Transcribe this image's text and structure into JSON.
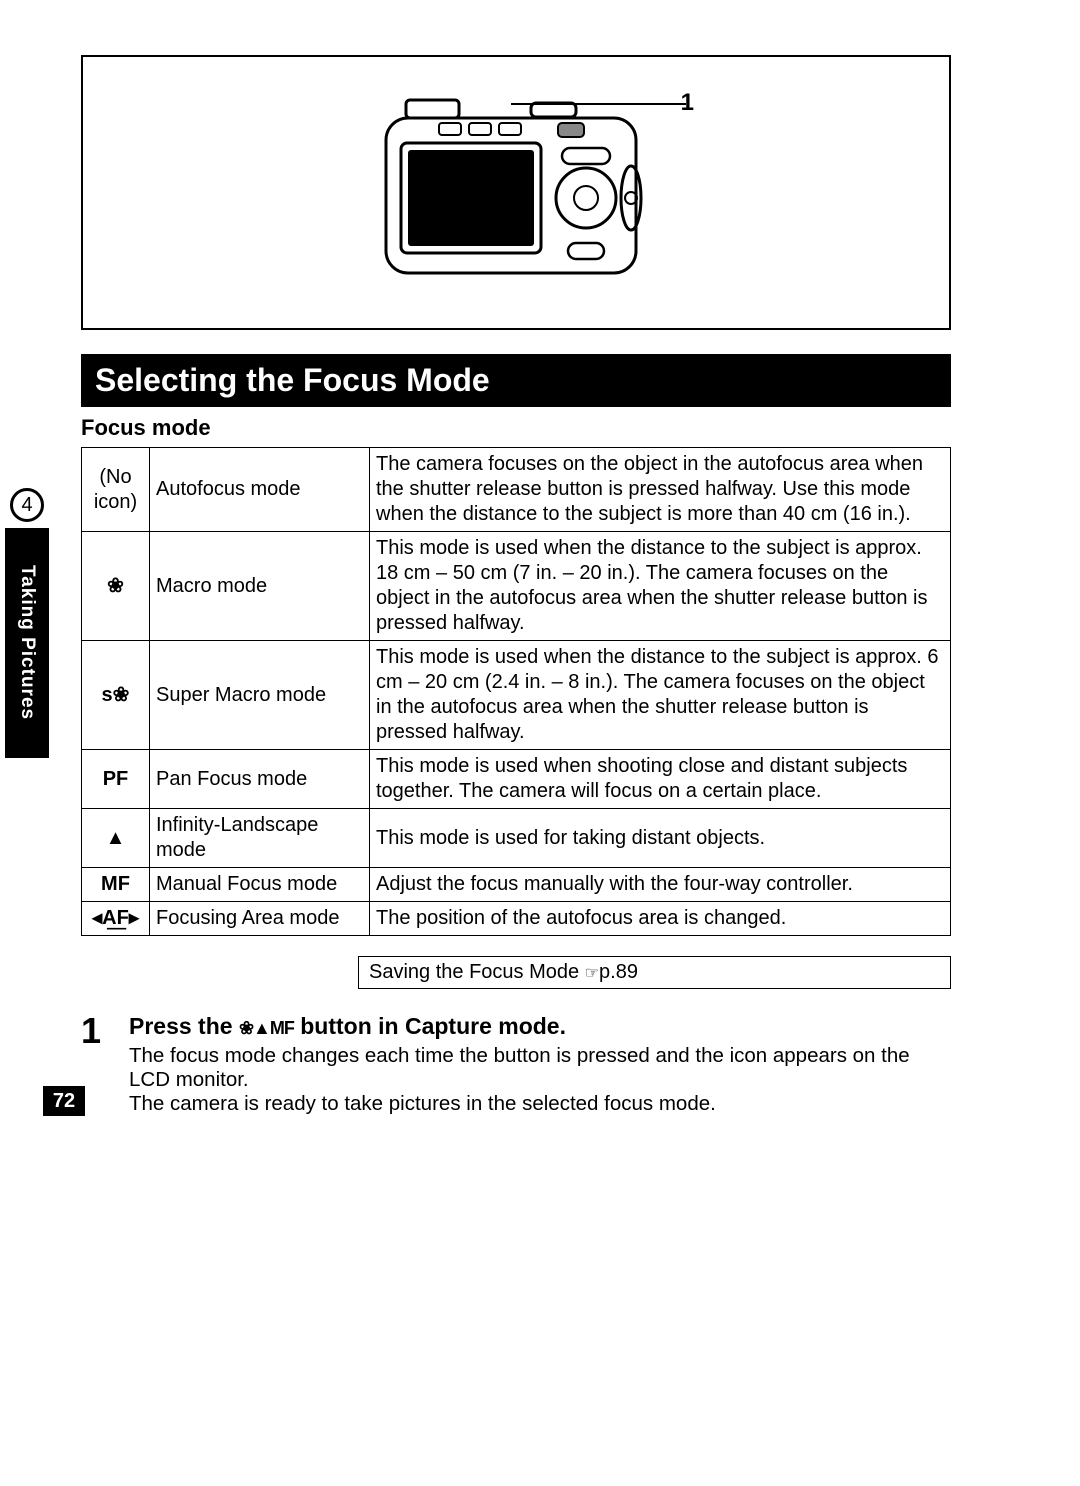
{
  "diagram": {
    "label": "1"
  },
  "section": {
    "title": "Selecting the Focus Mode",
    "subtitle": "Focus mode"
  },
  "sidebar": {
    "chapter_num": "4",
    "chapter_title": "Taking Pictures"
  },
  "focus_modes": [
    {
      "icon_text": "(No icon)",
      "icon_bold": false,
      "name": "Autofocus mode",
      "desc": "The camera focuses on the object in the autofocus area when the shutter release button is pressed halfway. Use this mode when the distance to the subject is more than 40 cm (16 in.)."
    },
    {
      "icon_text": "❀",
      "icon_bold": true,
      "name": "Macro mode",
      "desc": "This mode is used when the distance to the subject is approx. 18 cm – 50 cm (7 in. – 20 in.). The camera focuses on the object in the autofocus area when the shutter release button is pressed halfway."
    },
    {
      "icon_text": "s❀",
      "icon_bold": true,
      "name": "Super Macro mode",
      "desc": "This mode is used when the distance to the subject is approx. 6 cm – 20 cm (2.4 in. – 8 in.). The camera focuses on the object in the autofocus area when the shutter release button is pressed halfway."
    },
    {
      "icon_text": "PF",
      "icon_bold": true,
      "name": "Pan Focus mode",
      "desc": "This mode is used when shooting close and distant subjects together. The camera will focus on a certain place."
    },
    {
      "icon_text": "▲",
      "icon_bold": true,
      "name": "Infinity-Landscape mode",
      "desc": "This mode is used for taking distant objects."
    },
    {
      "icon_text": "MF",
      "icon_bold": true,
      "name": "Manual Focus mode",
      "desc": "Adjust the focus manually with the four-way controller."
    },
    {
      "icon_text": "◂A͟F▸",
      "icon_bold": true,
      "name": "Focusing Area mode",
      "desc": "The position of the autofocus area is changed."
    }
  ],
  "reference": {
    "text": "Saving the Focus Mode ",
    "hand": "☞",
    "page": "p.89"
  },
  "step": {
    "num": "1",
    "title_pre": "Press the ",
    "title_icons": "❀▲MF",
    "title_post": " button in Capture mode.",
    "body1": "The focus mode changes each time the button is pressed and the icon appears on the LCD monitor.",
    "body2": "The camera is ready to take pictures in the selected focus mode."
  },
  "page_number": "72"
}
